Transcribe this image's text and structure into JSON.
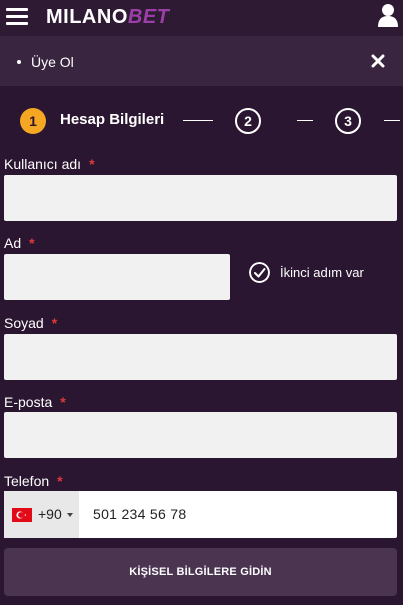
{
  "header": {
    "logo_part1": "MILANO",
    "logo_part2": "BET",
    "menu_icon": "hamburger-icon",
    "user_icon": "user-icon"
  },
  "subheader": {
    "title": "Üye Ol",
    "close_icon": "close-icon"
  },
  "steps": {
    "items": [
      {
        "number": "1",
        "label": "Hesap Bilgileri",
        "active": true
      },
      {
        "number": "2",
        "active": false
      },
      {
        "number": "3",
        "active": false
      }
    ]
  },
  "form": {
    "username": {
      "label": "Kullanıcı adı",
      "required": "*",
      "value": ""
    },
    "first_name": {
      "label": "Ad",
      "required": "*",
      "value": ""
    },
    "second_name_checkbox": {
      "label": "İkinci adım var",
      "checked": true
    },
    "last_name": {
      "label": "Soyad",
      "required": "*",
      "value": ""
    },
    "email": {
      "label": "E-posta",
      "required": "*",
      "value": ""
    },
    "phone": {
      "label": "Telefon",
      "required": "*",
      "country_flag": "turkey-flag-icon",
      "dial_code": "+90",
      "value": "501 234 56 78"
    },
    "submit_label": "KİŞİSEL BİLGİLERE GİDİN"
  },
  "colors": {
    "background": "#2a1630",
    "accent": "#f5a623",
    "required": "#e0383b",
    "brand_secondary": "#9b3fa8"
  }
}
